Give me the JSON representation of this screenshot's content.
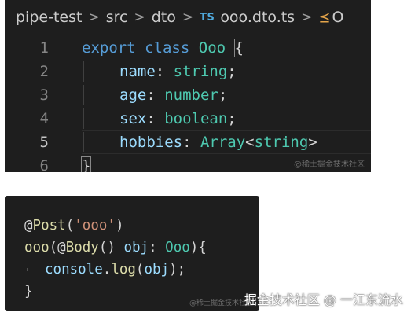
{
  "breadcrumb": {
    "items": [
      "pipe-test",
      "src",
      "dto",
      "ooo.dto.ts",
      "O"
    ],
    "file_badge": "TS",
    "separator": ">"
  },
  "editor": {
    "lines": [
      {
        "number": "1",
        "tokens": [
          [
            "export",
            "kw"
          ],
          [
            " ",
            "punc"
          ],
          [
            "class",
            "kw"
          ],
          [
            " ",
            "punc"
          ],
          [
            "Ooo",
            "cls"
          ],
          [
            " ",
            "punc"
          ],
          [
            "{",
            "brace"
          ]
        ],
        "indent": 0
      },
      {
        "number": "2",
        "tokens": [
          [
            "name",
            "prop"
          ],
          [
            ": ",
            "punc"
          ],
          [
            "string",
            "cls"
          ],
          [
            ";",
            "punc"
          ]
        ],
        "indent": 1
      },
      {
        "number": "3",
        "tokens": [
          [
            "age",
            "prop"
          ],
          [
            ": ",
            "punc"
          ],
          [
            "number",
            "cls"
          ],
          [
            ";",
            "punc"
          ]
        ],
        "indent": 1
      },
      {
        "number": "4",
        "tokens": [
          [
            "sex",
            "prop"
          ],
          [
            ": ",
            "punc"
          ],
          [
            "boolean",
            "cls"
          ],
          [
            ";",
            "punc"
          ]
        ],
        "indent": 1
      },
      {
        "number": "5",
        "tokens": [
          [
            "hobbies",
            "prop"
          ],
          [
            ": ",
            "punc"
          ],
          [
            "Array",
            "cls"
          ],
          [
            "<",
            "punc"
          ],
          [
            "string",
            "cls"
          ],
          [
            ">",
            "punc"
          ]
        ],
        "indent": 1,
        "active": true
      },
      {
        "number": "6",
        "tokens": [
          [
            "}",
            "brace"
          ]
        ],
        "indent": 0
      }
    ],
    "watermark": "@稀土掘金技术社区"
  },
  "snippet": {
    "lines": [
      {
        "tokens": [
          [
            "@",
            "punc"
          ],
          [
            "Post",
            "fn"
          ],
          [
            "(",
            "punc"
          ],
          [
            "'ooo'",
            "str"
          ],
          [
            ")",
            "punc"
          ]
        ],
        "indent": 0
      },
      {
        "tokens": [
          [
            "ooo",
            "fn"
          ],
          [
            "(",
            "punc"
          ],
          [
            "@",
            "punc"
          ],
          [
            "Body",
            "fn"
          ],
          [
            "() ",
            "punc"
          ],
          [
            "obj",
            "param"
          ],
          [
            ": ",
            "punc"
          ],
          [
            "Ooo",
            "cls"
          ],
          [
            "){",
            "punc"
          ]
        ],
        "indent": 0
      },
      {
        "tokens": [
          [
            "console",
            "param"
          ],
          [
            ".",
            "punc"
          ],
          [
            "log",
            "fn"
          ],
          [
            "(",
            "punc"
          ],
          [
            "obj",
            "param"
          ],
          [
            ");",
            "punc"
          ]
        ],
        "indent": 1
      },
      {
        "tokens": [
          [
            "}",
            "punc"
          ]
        ],
        "indent": 0
      }
    ],
    "watermark": "@稀土掘金技术社区"
  },
  "watermark": "掘金技术社区 @ 一江东流水",
  "colors": {
    "background": "#1e1e1e",
    "keyword": "#569cd6",
    "type": "#4ec9b0",
    "property": "#9cdcfe",
    "function": "#dcdcaa",
    "string": "#ce9178"
  }
}
